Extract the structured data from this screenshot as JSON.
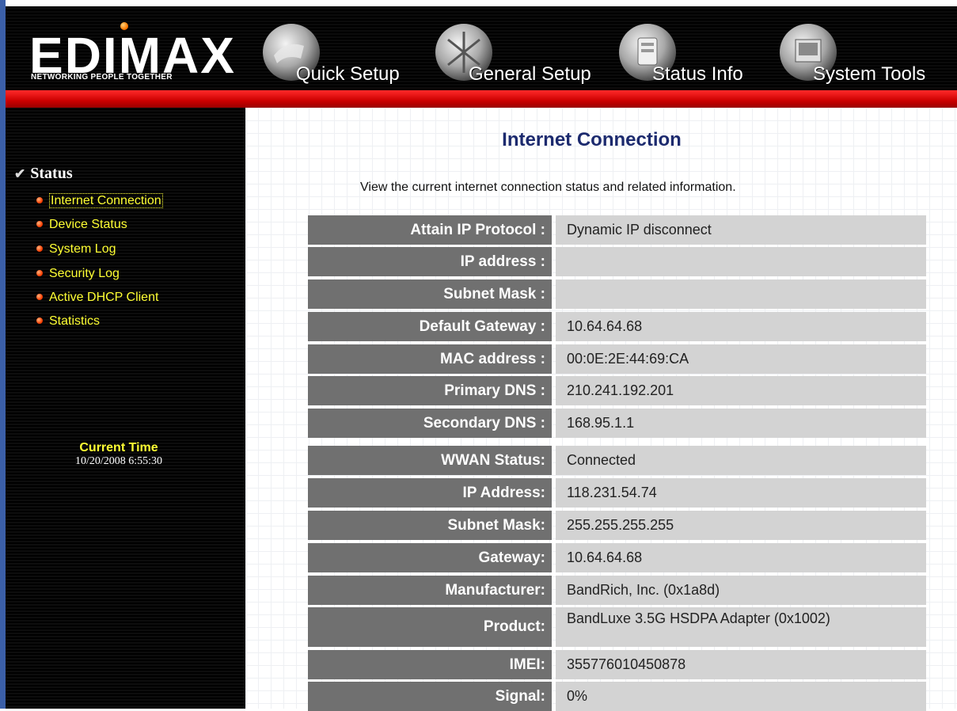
{
  "brand": {
    "name": "EDIMAX",
    "tagline": "NETWORKING PEOPLE TOGETHER"
  },
  "nav": [
    {
      "label": "Quick Setup",
      "icon": "quick-setup-icon"
    },
    {
      "label": "General Setup",
      "icon": "general-setup-icon"
    },
    {
      "label": "Status Info",
      "icon": "status-info-icon"
    },
    {
      "label": "System Tools",
      "icon": "system-tools-icon"
    }
  ],
  "sidebar": {
    "heading": "Status",
    "items": [
      {
        "label": "Internet Connection"
      },
      {
        "label": "Device Status"
      },
      {
        "label": "System Log"
      },
      {
        "label": "Security Log"
      },
      {
        "label": "Active DHCP Client"
      },
      {
        "label": "Statistics"
      }
    ],
    "time_label": "Current Time",
    "time_value": "10/20/2008 6:55:30"
  },
  "main": {
    "title": "Internet Connection",
    "description": "View the current internet connection status and related information.",
    "table1": [
      {
        "key": "Attain IP Protocol :",
        "value": "Dynamic IP disconnect"
      },
      {
        "key": "IP address :",
        "value": ""
      },
      {
        "key": "Subnet Mask :",
        "value": ""
      },
      {
        "key": "Default Gateway :",
        "value": "10.64.64.68"
      },
      {
        "key": "MAC address :",
        "value": "00:0E:2E:44:69:CA"
      },
      {
        "key": "Primary DNS :",
        "value": "210.241.192.201"
      },
      {
        "key": "Secondary DNS :",
        "value": "168.95.1.1"
      }
    ],
    "table2": [
      {
        "key": "WWAN Status:",
        "value": "Connected"
      },
      {
        "key": "IP Address:",
        "value": "118.231.54.74"
      },
      {
        "key": "Subnet Mask:",
        "value": "255.255.255.255"
      },
      {
        "key": "Gateway:",
        "value": "10.64.64.68"
      },
      {
        "key": "Manufacturer:",
        "value": "BandRich, Inc. (0x1a8d)"
      },
      {
        "key": "Product:",
        "value": "BandLuxe 3.5G HSDPA Adapter (0x1002)"
      },
      {
        "key": "IMEI:",
        "value": "355776010450878"
      },
      {
        "key": "Signal:",
        "value": "0%"
      }
    ]
  },
  "colors": {
    "accent_red": "#cc0000",
    "menu_yellow": "#ffff33",
    "title_navy": "#1c2a6e",
    "key_cell": "#707070",
    "value_cell": "#d3d3d3"
  }
}
